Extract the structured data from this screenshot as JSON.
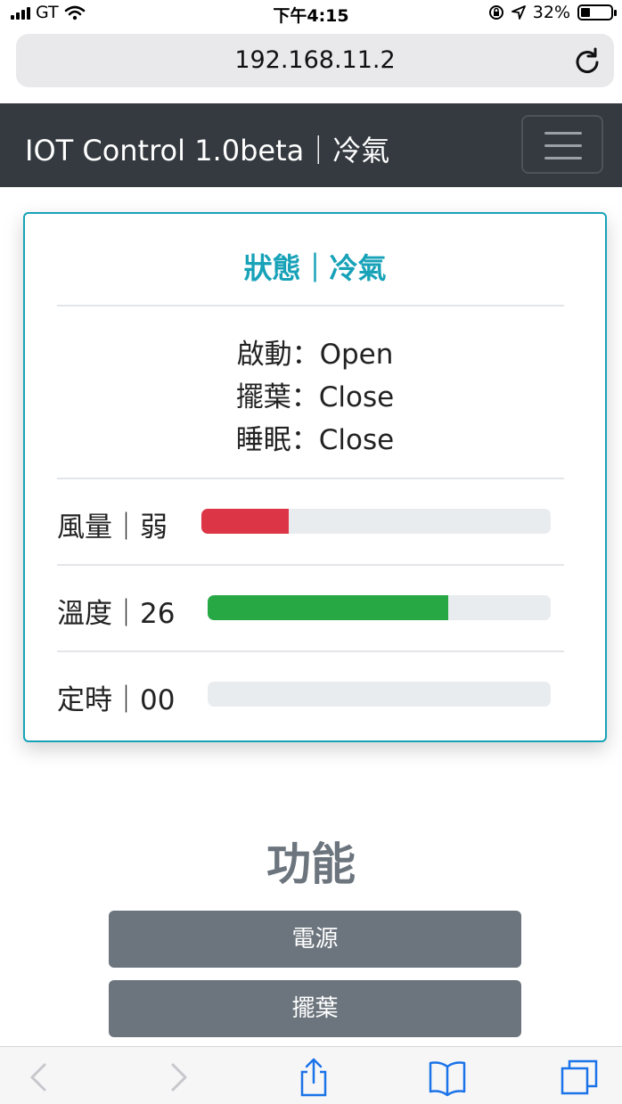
{
  "status_bar": {
    "carrier": "GT",
    "time": "下午4:15",
    "battery": "32%",
    "battery_level": 0.32
  },
  "browser": {
    "url": "192.168.11.2"
  },
  "navbar": {
    "brand": "IOT Control 1.0beta｜冷氣"
  },
  "status_card": {
    "title": "狀態｜冷氣",
    "states": [
      {
        "text": "啟動：Open"
      },
      {
        "text": "擺葉：Close"
      },
      {
        "text": "睡眠：Close"
      }
    ],
    "metrics": [
      {
        "label": "風量｜弱",
        "fill": 0.25,
        "color": "#dc3545"
      },
      {
        "label": "溫度｜26",
        "fill": 0.7,
        "color": "#28a745"
      },
      {
        "label": "定時｜00",
        "fill": 0.0,
        "color": "#007bff"
      }
    ]
  },
  "functions": {
    "title": "功能",
    "buttons": [
      {
        "label": "電源"
      },
      {
        "label": "擺葉"
      }
    ]
  },
  "colors": {
    "navbar": "#343a40",
    "accent": "#17a2b8",
    "button": "#6c757d",
    "icon": "#1a73e8"
  }
}
